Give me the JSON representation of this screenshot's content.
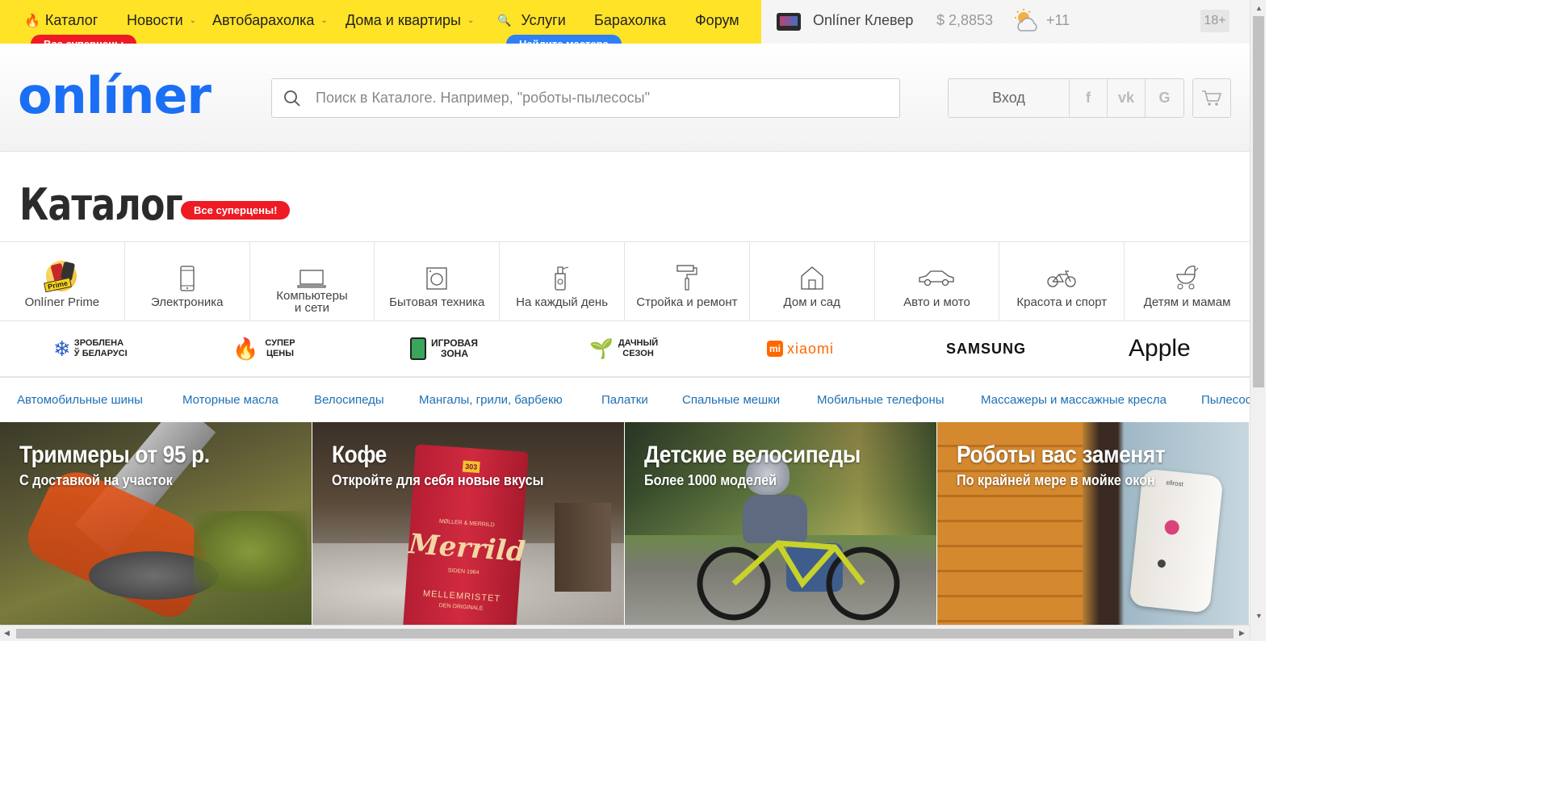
{
  "topnav": {
    "items": [
      {
        "label": "Каталог",
        "dropdown": false
      },
      {
        "label": "Новости",
        "dropdown": true
      },
      {
        "label": "Автобарахолка",
        "dropdown": true
      },
      {
        "label": "Дома и квартиры",
        "dropdown": true
      },
      {
        "label": "Услуги",
        "dropdown": false
      },
      {
        "label": "Барахолка",
        "dropdown": false
      },
      {
        "label": "Форум",
        "dropdown": false
      }
    ],
    "catalog_badge": "Все суперцены",
    "services_badge": "Найдите мастера",
    "clever_label": "Onlíner Клевер",
    "currency": "$ 2,8853",
    "weather": "+11",
    "age": "18+",
    "accent_color": "#ffe326"
  },
  "header": {
    "logo": "onlíner",
    "search_placeholder": "Поиск в Каталоге. Например, \"роботы-пылесосы\"",
    "login_label": "Вход",
    "social": [
      "f",
      "vk",
      "G"
    ]
  },
  "catalog": {
    "title": "Каталог",
    "badge": "Все суперцены!",
    "categories": [
      {
        "label": "Onlíner Prime",
        "icon": "prime-icon"
      },
      {
        "label": "Электроника",
        "icon": "phone-icon"
      },
      {
        "label": "Компьютеры\nи сети",
        "icon": "laptop-icon"
      },
      {
        "label": "Бытовая техника",
        "icon": "washer-icon"
      },
      {
        "label": "На каждый день",
        "icon": "spray-icon"
      },
      {
        "label": "Стройка и ремонт",
        "icon": "paint-roller-icon"
      },
      {
        "label": "Дом и сад",
        "icon": "house-icon"
      },
      {
        "label": "Авто и мото",
        "icon": "car-icon"
      },
      {
        "label": "Красота и спорт",
        "icon": "bicycle-icon"
      },
      {
        "label": "Детям и мамам",
        "icon": "stroller-icon"
      }
    ],
    "prime_badge": "Prime"
  },
  "brands": {
    "belarus_line1": "ЗРОБЛЕНА",
    "belarus_line2": "Ў БЕЛАРУСІ",
    "super_line1": "СУПЕР",
    "super_line2": "ЦЕНЫ",
    "game_line1": "ИГРОВАЯ",
    "game_line2": "ЗОНА",
    "dacha_line1": "ДАЧНЫЙ",
    "dacha_line2": "СЕЗОН",
    "xiaomi_mi": "mi",
    "xiaomi": "xiaomi",
    "samsung": "SAMSUNG",
    "apple": "Apple"
  },
  "quick_links": [
    "Автомобильные шины",
    "Моторные масла",
    "Велосипеды",
    "Мангалы, грили, барбекю",
    "Палатки",
    "Спальные мешки",
    "Мобильные телефоны",
    "Массажеры и массажные кресла",
    "Пылесосы"
  ],
  "promos": [
    {
      "title": "Триммеры от 95 р.",
      "subtitle": "С доставкой на участок"
    },
    {
      "title": "Кофе",
      "subtitle": "Откройте для себя новые вкусы",
      "pack_brand": "Merrild",
      "pack_name": "MELLEMRISTET",
      "pack_top": "MØLLER & MERRILD",
      "pack_since": "SIDEN 1964",
      "pack_small": "DEN ORIGINALE",
      "pack_num": "303"
    },
    {
      "title": "Детские велосипеды",
      "subtitle": "Более 1000 моделей"
    },
    {
      "title": "Роботы вас заменят",
      "subtitle": "По крайней мере в мойке окон",
      "robot_brand": "ellrost"
    }
  ]
}
